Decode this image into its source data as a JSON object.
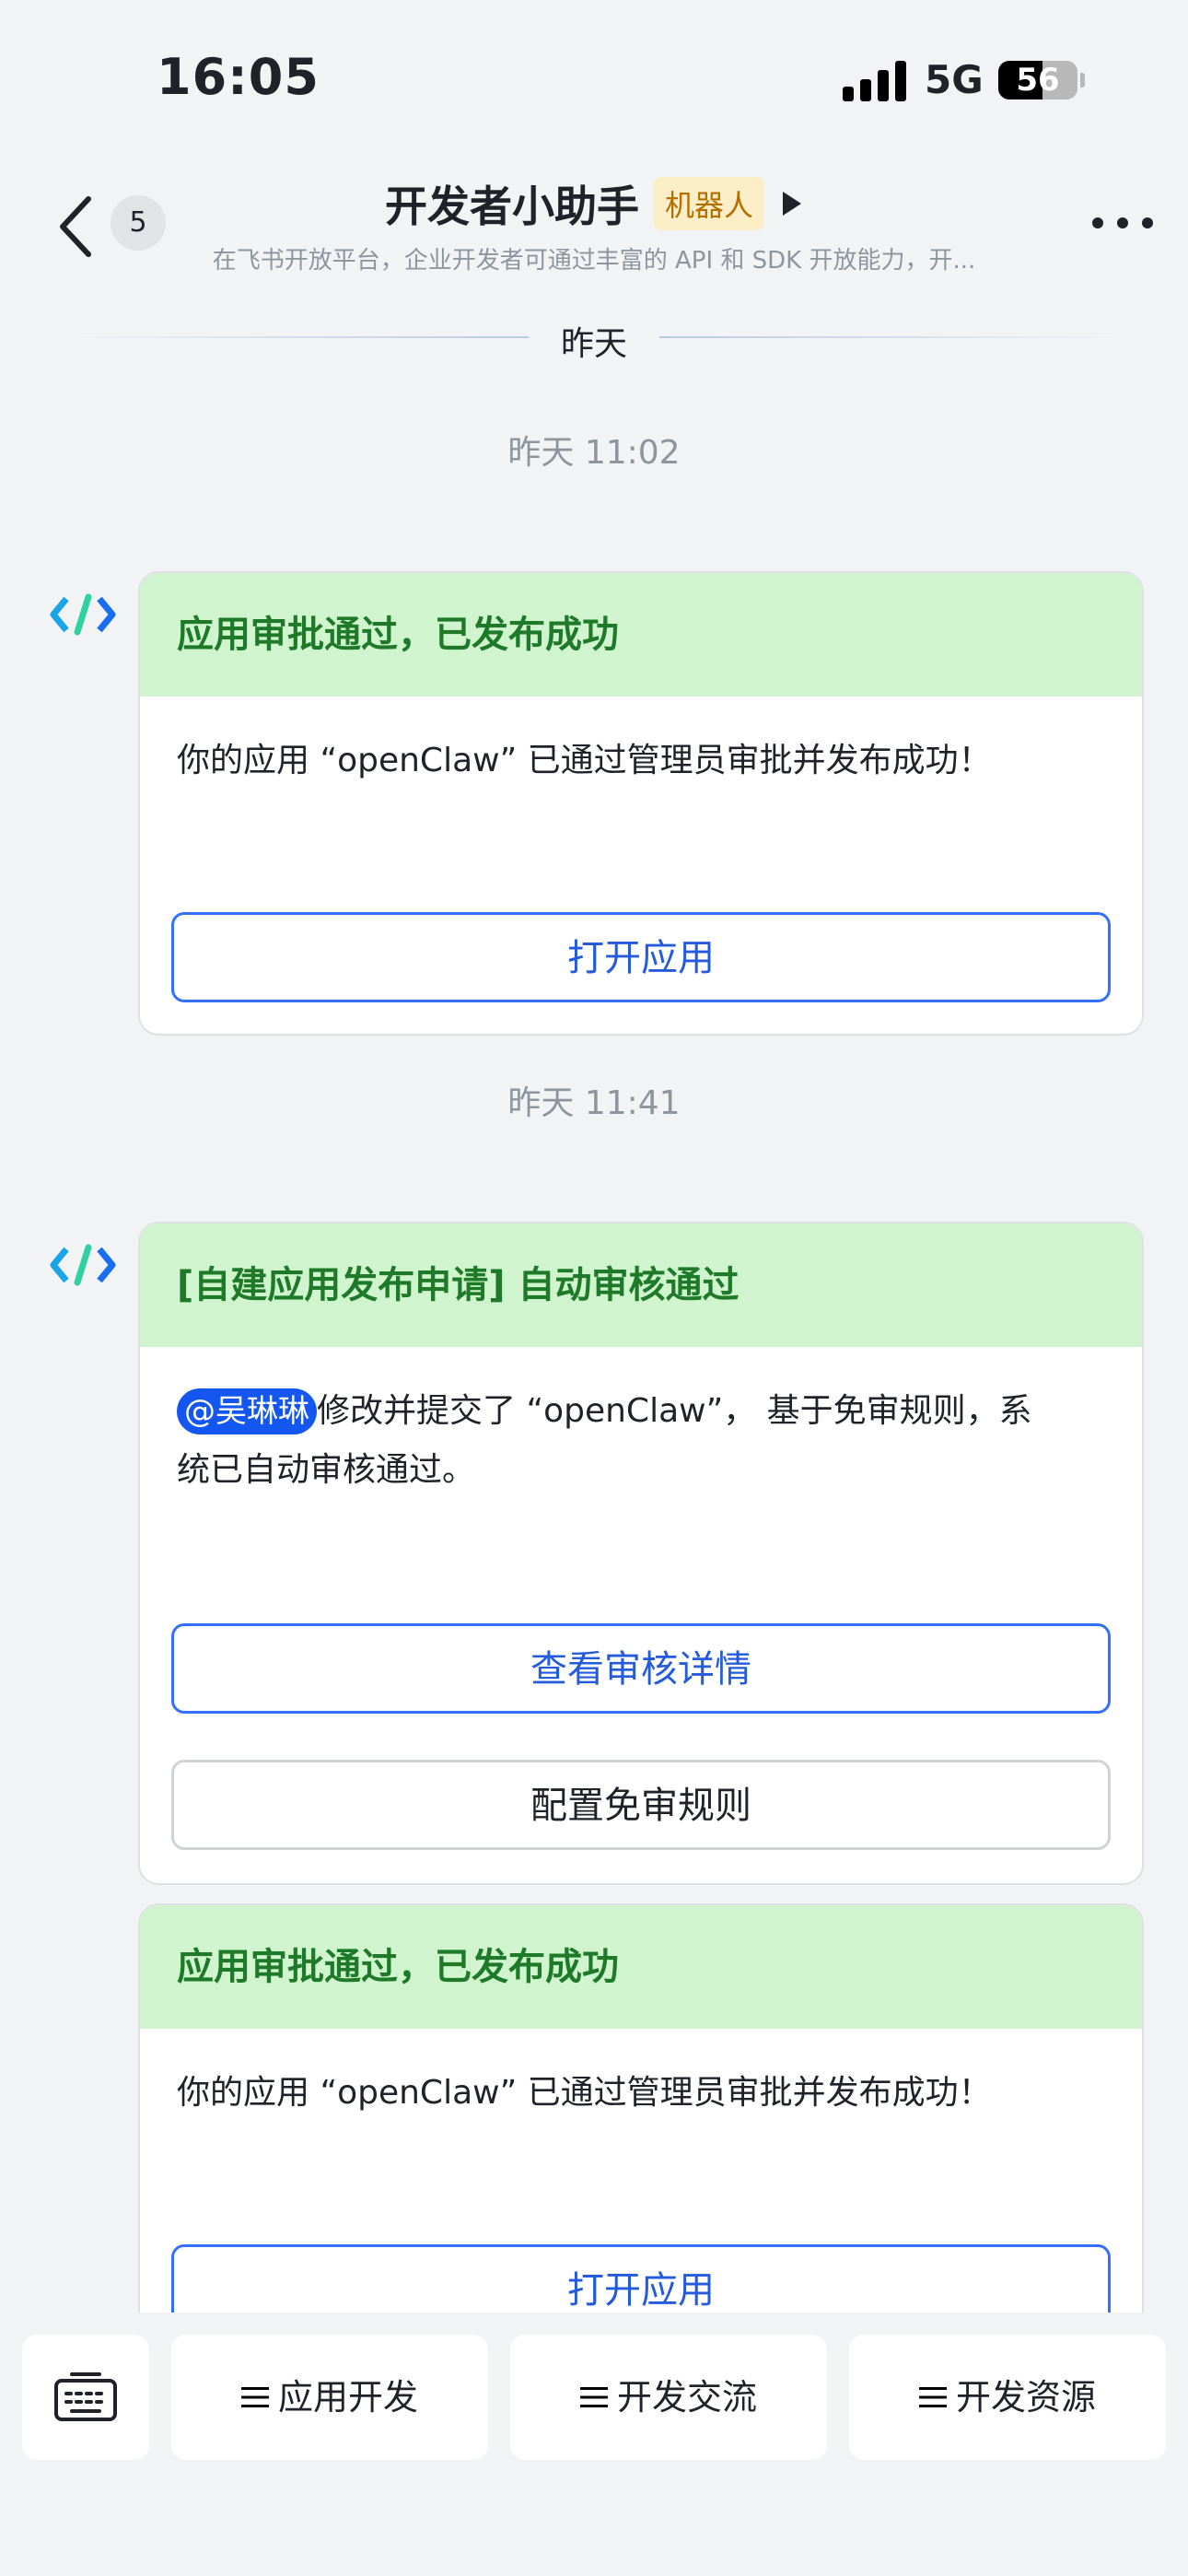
{
  "status_bar": {
    "time": "16:05",
    "network": "5G",
    "battery": "56",
    "battery_level": 0.56
  },
  "header": {
    "unread_count": "5",
    "title": "开发者小助手",
    "tag": "机器人",
    "subtitle": "在飞书开放平台，企业开发者可通过丰富的 API 和 SDK 开放能力，开..."
  },
  "chat": {
    "day_divider": "昨天",
    "messages": [
      {
        "time": "昨天 11:02",
        "card_title": "应用审批通过，已发布成功",
        "card_body": "你的应用 “openClaw” 已通过管理员审批并发布成功！",
        "button": "打开应用"
      },
      {
        "time": "昨天 11:41",
        "card_title": "[自建应用发布申请] 自动审核通过",
        "mention": "@吴琳琳",
        "card_body_line1": "修改并提交了 “openClaw”， 基于免审规则，系",
        "card_body_line2": "统已自动审核通过。",
        "button_primary": "查看审核详情",
        "button_secondary": "配置免审规则"
      },
      {
        "card_title": "应用审批通过，已发布成功",
        "card_body": "你的应用 “openClaw” 已通过管理员审批并发布成功！",
        "button": "打开应用"
      }
    ]
  },
  "bottom_menu": {
    "items": [
      "应用开发",
      "开发交流",
      "开发资源"
    ]
  }
}
